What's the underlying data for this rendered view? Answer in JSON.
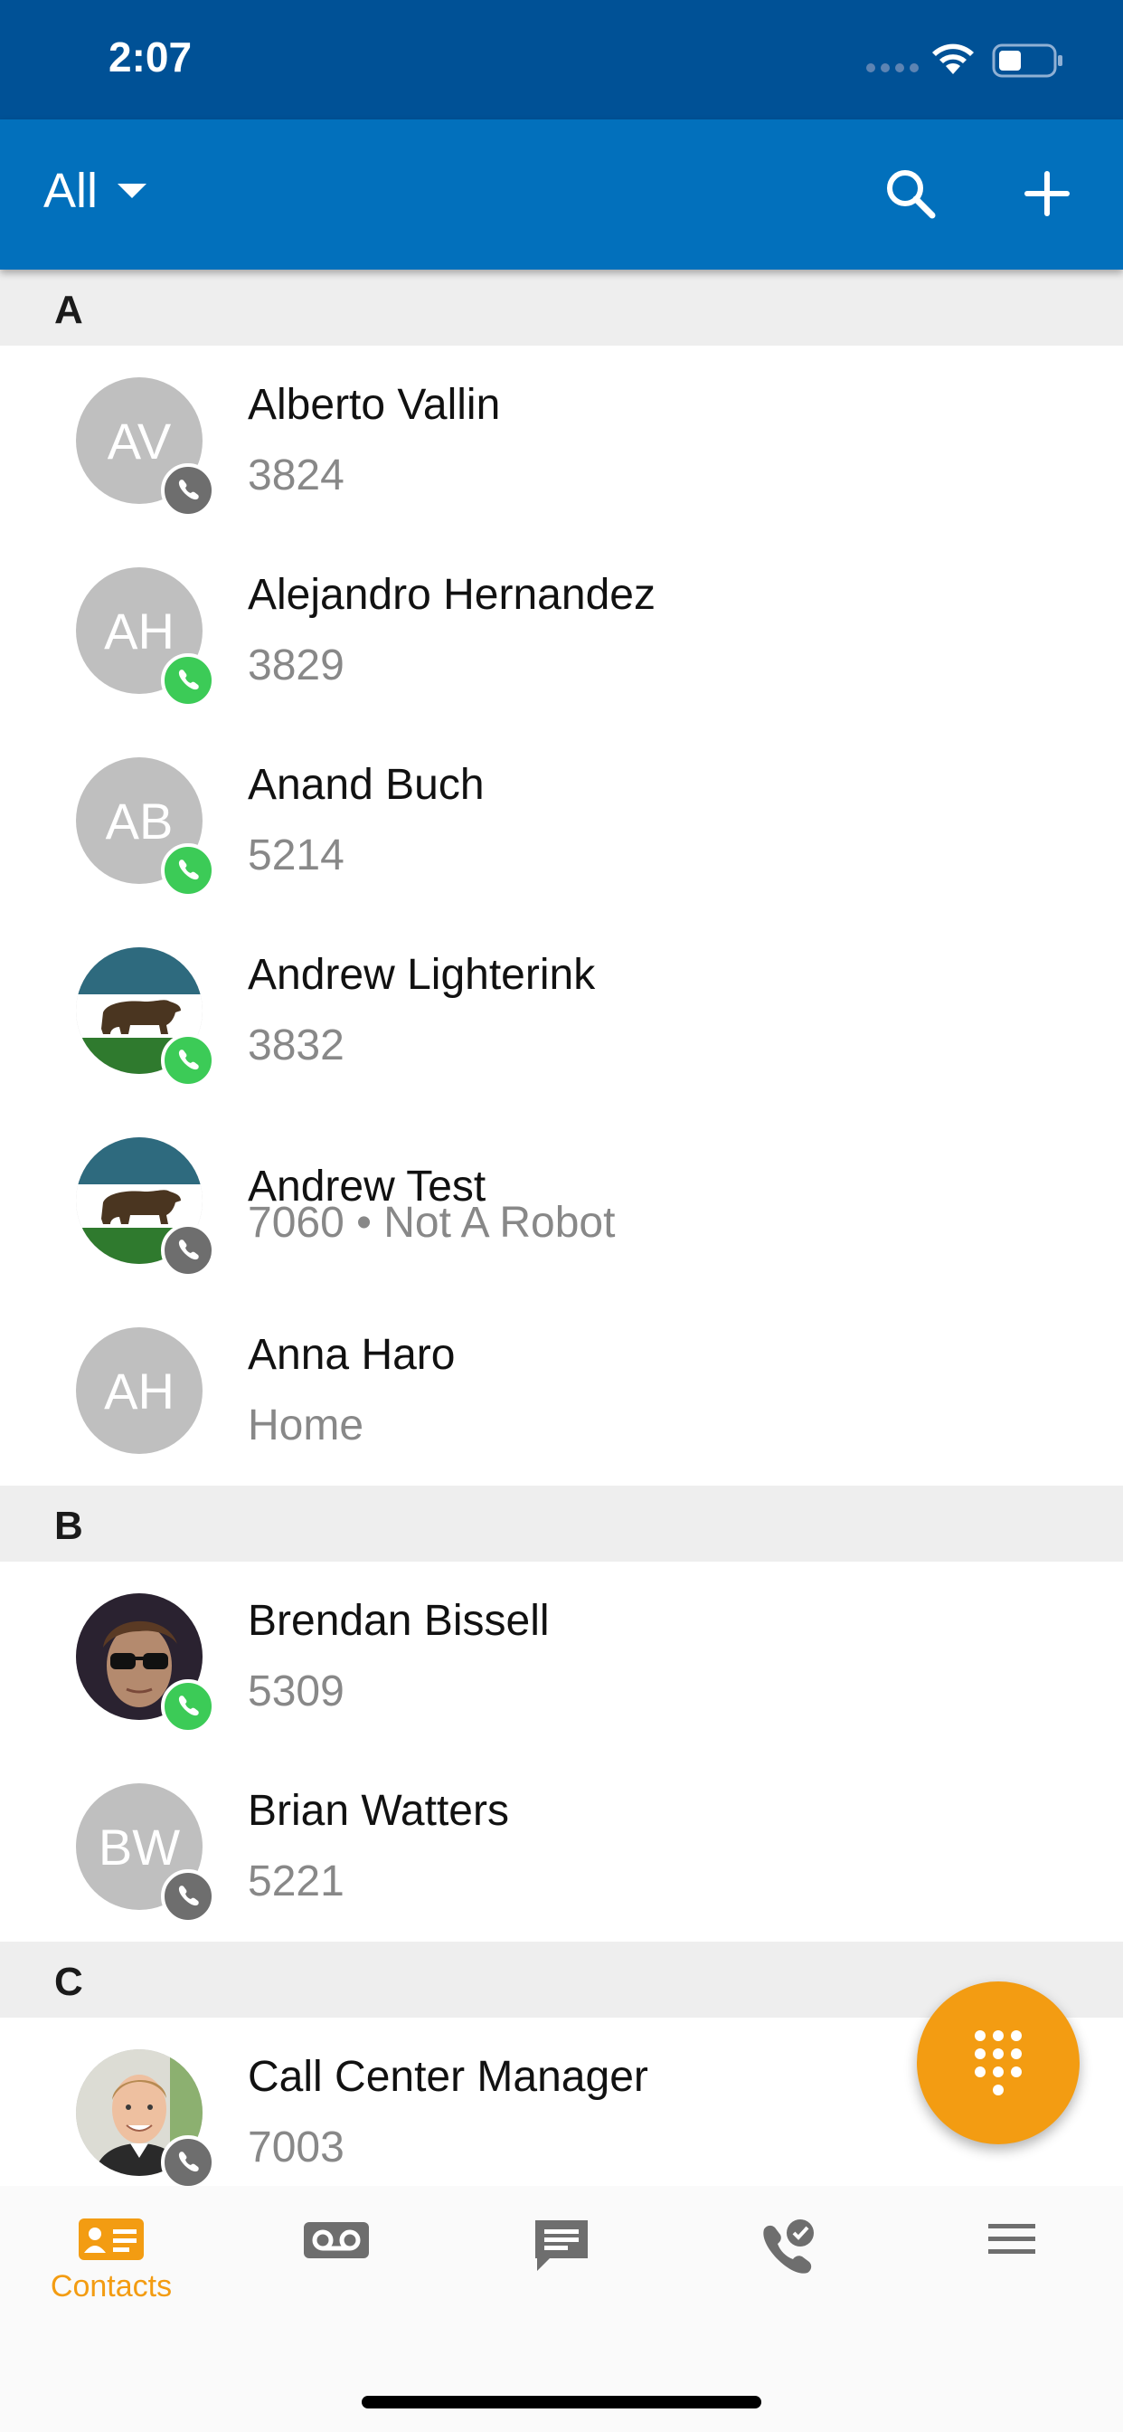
{
  "status_bar": {
    "time": "2:07"
  },
  "app_bar": {
    "filter_label": "All"
  },
  "sections": [
    {
      "letter": "A",
      "contacts": [
        {
          "name": "Alberto Vallin",
          "detail": "3824",
          "initials": "AV",
          "avatar": "initials",
          "presence": "gray"
        },
        {
          "name": "Alejandro Hernandez",
          "detail": "3829",
          "initials": "AH",
          "avatar": "initials",
          "presence": "green"
        },
        {
          "name": "Anand Buch",
          "detail": "5214",
          "initials": "AB",
          "avatar": "initials",
          "presence": "green"
        },
        {
          "name": "Andrew Lighterink",
          "detail": "3832",
          "initials": "",
          "avatar": "bear-flag",
          "presence": "green"
        },
        {
          "name": "Andrew Test",
          "detail": "7060 • Not A Robot",
          "initials": "",
          "avatar": "bear-flag",
          "presence": "gray"
        },
        {
          "name": "Anna Haro",
          "detail": "Home",
          "initials": "AH",
          "avatar": "initials",
          "presence": "none"
        }
      ]
    },
    {
      "letter": "B",
      "contacts": [
        {
          "name": "Brendan Bissell",
          "detail": "5309",
          "initials": "",
          "avatar": "photo-sunglasses",
          "presence": "green"
        },
        {
          "name": "Brian Watters",
          "detail": "5221",
          "initials": "BW",
          "avatar": "initials",
          "presence": "gray"
        }
      ]
    },
    {
      "letter": "C",
      "contacts": [
        {
          "name": "Call Center Manager",
          "detail": "7003",
          "initials": "",
          "avatar": "photo-man",
          "presence": "gray"
        }
      ]
    }
  ],
  "tab_bar": {
    "tabs": [
      {
        "label": "Contacts",
        "icon": "contacts-card-icon",
        "active": true
      },
      {
        "label": "",
        "icon": "voicemail-icon",
        "active": false
      },
      {
        "label": "",
        "icon": "chat-icon",
        "active": false
      },
      {
        "label": "",
        "icon": "call-history-icon",
        "active": false
      },
      {
        "label": "",
        "icon": "menu-icon",
        "active": false
      }
    ]
  },
  "colors": {
    "status_bar": "#005196",
    "app_bar": "#0270bc",
    "accent": "#f39c12",
    "presence_green": "#3ccb57",
    "presence_gray": "#6e6e6e",
    "section_header": "#eeeeee"
  }
}
